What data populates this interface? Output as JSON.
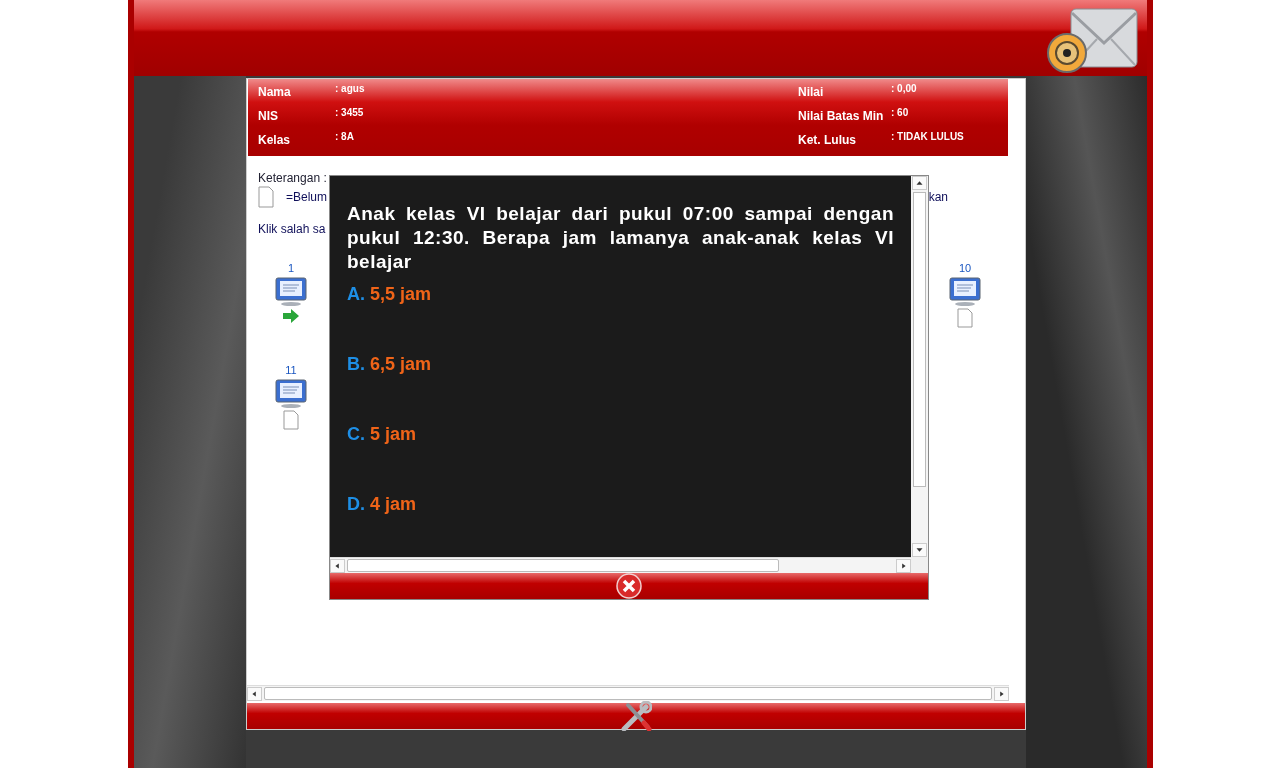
{
  "student": {
    "left": [
      {
        "label": "Nama",
        "value": ": agus"
      },
      {
        "label": "NIS",
        "value": ": 3455"
      },
      {
        "label": "Kelas",
        "value": ": 8A"
      }
    ],
    "right": [
      {
        "label": "Nilai",
        "value": ": 0,00"
      },
      {
        "label": "Nilai Batas Min",
        "value": ": 60"
      },
      {
        "label": "Ket. Lulus",
        "value": ": TIDAK LULUS"
      }
    ]
  },
  "legend": {
    "title": "Keterangan :",
    "items": [
      {
        "kind": "unanswered",
        "label": "=Belum"
      }
    ],
    "fragment": "kan"
  },
  "instruction": "Klik salah sa",
  "question_rows": [
    [
      {
        "number": "1",
        "kind": "current"
      },
      {
        "number": "10",
        "kind": "unanswered"
      }
    ],
    [
      {
        "number": "11",
        "kind": "unanswered"
      }
    ]
  ],
  "modal": {
    "question": "Anak kelas VI belajar dari pukul 07:00 sampai dengan pukul 12:30. Berapa jam lamanya anak-anak kelas VI belajar",
    "options": [
      {
        "letter": "A.",
        "text": "5,5 jam"
      },
      {
        "letter": "B.",
        "text": "6,5 jam"
      },
      {
        "letter": "C.",
        "text": "5 jam"
      },
      {
        "letter": "D.",
        "text": "4 jam"
      }
    ]
  }
}
